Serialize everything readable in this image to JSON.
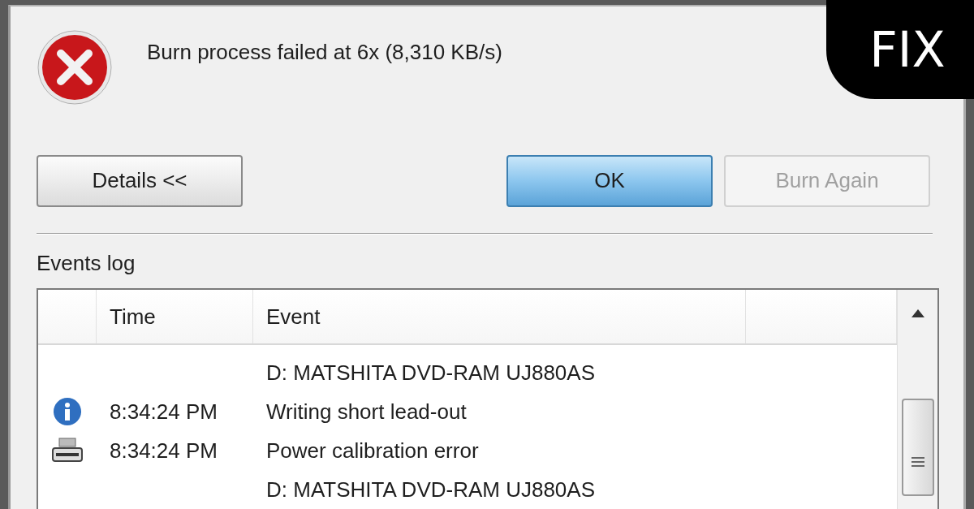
{
  "message": "Burn process failed at 6x (8,310 KB/s)",
  "buttons": [
    {
      "label": "Details <<",
      "default": false,
      "disabled": false
    },
    {
      "label": "OK",
      "default": true,
      "disabled": false
    },
    {
      "label": "Burn Again",
      "default": false,
      "disabled": true
    }
  ],
  "events_log": {
    "label": "Events log",
    "columns": [
      "Time",
      "Event"
    ],
    "rows": [
      {
        "kind": "none",
        "event": "D: MATSHITA DVD-RAM UJ880AS"
      },
      {
        "kind": "info",
        "time": "8:34:24 PM",
        "event": "Writing short lead-out"
      },
      {
        "kind": "device",
        "time": "8:34:24 PM",
        "event": "Power calibration error"
      },
      {
        "kind": "none",
        "event": "D: MATSHITA DVD-RAM UJ880AS"
      }
    ]
  },
  "badge": "FIX"
}
